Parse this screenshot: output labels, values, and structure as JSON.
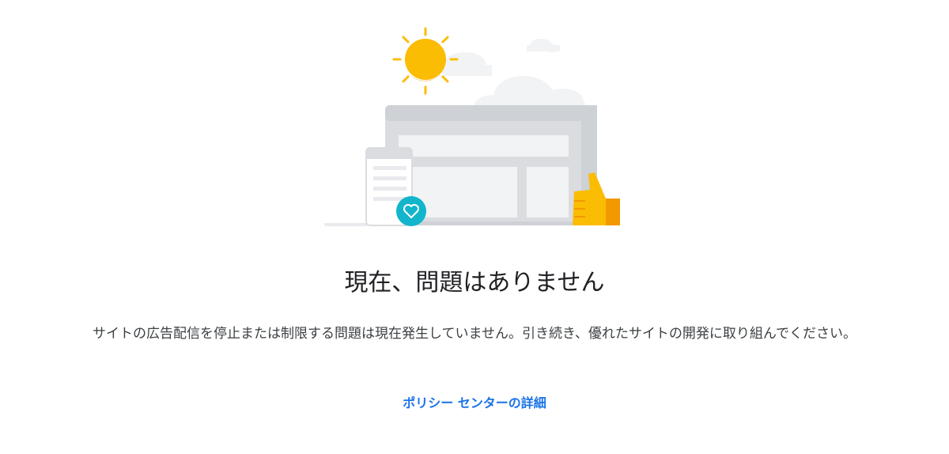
{
  "main": {
    "title": "現在、問題はありません",
    "description": "サイトの広告配信を停止または制限する問題は現在発生していません。引き続き、優れたサイトの開発に取り組んでください。",
    "policy_link_label": "ポリシー センターの詳細"
  },
  "illustration": {
    "icons": [
      "sun-icon",
      "cloud-icon",
      "browser-window-icon",
      "mobile-device-icon",
      "heart-icon",
      "thumbs-up-icon"
    ]
  },
  "colors": {
    "sun": "#fbbc04",
    "thumb": "#fbbc04",
    "heart_badge": "#12b5cb",
    "link": "#1a73e8",
    "frame": "#dadce0",
    "panel": "#f1f3f4"
  }
}
